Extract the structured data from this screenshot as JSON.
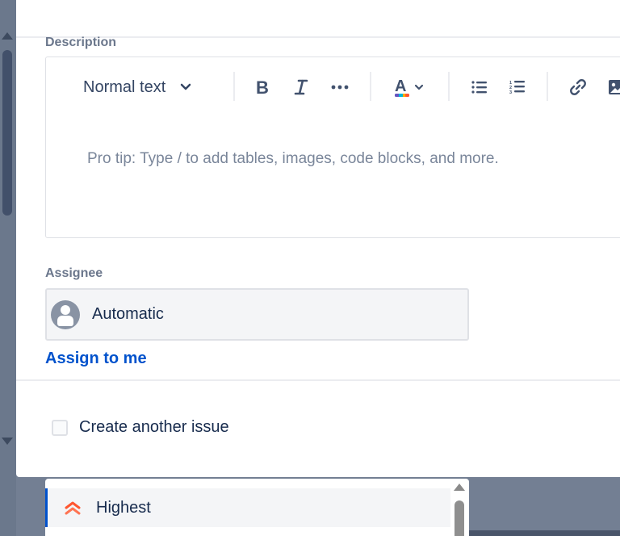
{
  "description": {
    "label": "Description",
    "toolbar": {
      "text_style": "Normal text",
      "items": [
        {
          "name": "bold",
          "icon": "bold-icon"
        },
        {
          "name": "italic",
          "icon": "italic-icon"
        },
        {
          "name": "more-formatting",
          "icon": "more-icon"
        },
        {
          "name": "text-color",
          "icon": "text-color-icon"
        },
        {
          "name": "bullet-list",
          "icon": "bullet-list-icon"
        },
        {
          "name": "numbered-list",
          "icon": "numbered-list-icon"
        },
        {
          "name": "link",
          "icon": "link-icon"
        },
        {
          "name": "image",
          "icon": "image-icon"
        }
      ]
    },
    "placeholder": "Pro tip: Type / to add tables, images, code blocks, and more."
  },
  "assignee": {
    "label": "Assignee",
    "value": "Automatic",
    "assign_to_me": "Assign to me"
  },
  "create_another": {
    "label": "Create another issue",
    "checked": false
  },
  "priority_dropdown": {
    "options": [
      {
        "label": "Highest",
        "icon": "priority-highest-icon",
        "color": "#ff5630",
        "selected": true
      }
    ]
  },
  "colors": {
    "accent": "#0052cc",
    "text": "#172b4d",
    "muted": "#6b778c",
    "priority_highest": "#ff5630"
  }
}
